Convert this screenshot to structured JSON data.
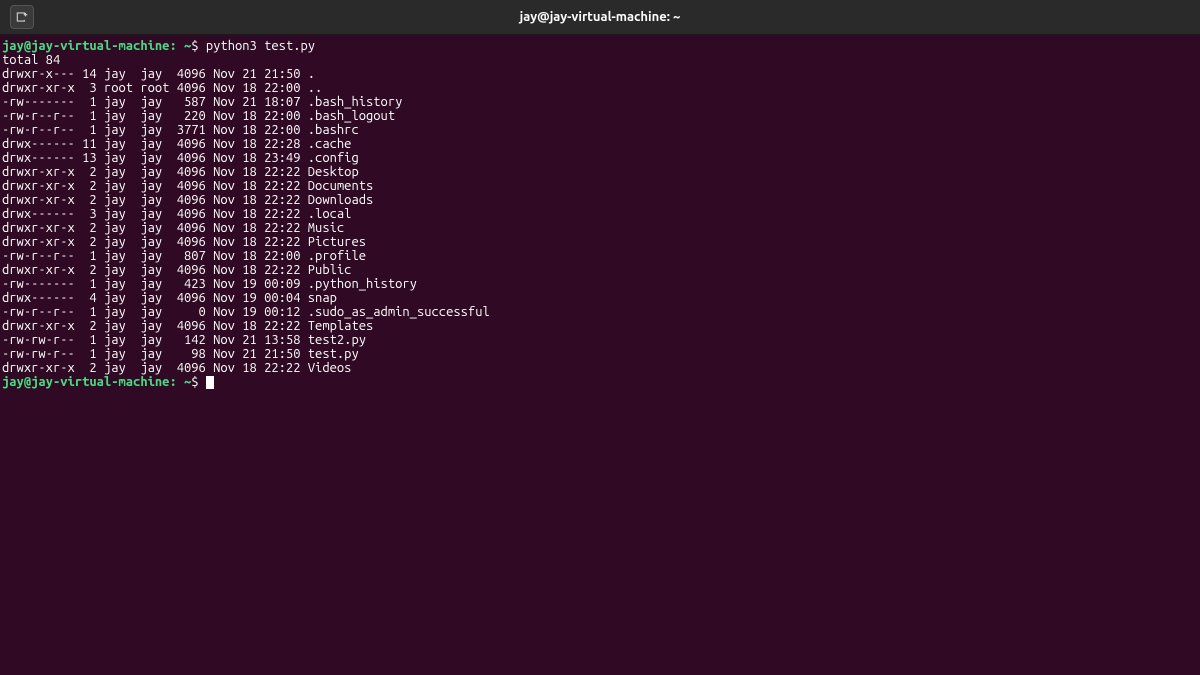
{
  "titlebar": {
    "title": "jay@jay-virtual-machine: ~"
  },
  "prompt1": {
    "userhost": "jay@jay-virtual-machine",
    "sep": ":",
    "path": " ~",
    "dollar": "$ ",
    "command": "python3 test.py"
  },
  "output": {
    "total": "total 84",
    "lines": [
      "drwxr-x--- 14 jay  jay  4096 Nov 21 21:50 .",
      "drwxr-xr-x  3 root root 4096 Nov 18 22:00 ..",
      "-rw-------  1 jay  jay   587 Nov 21 18:07 .bash_history",
      "-rw-r--r--  1 jay  jay   220 Nov 18 22:00 .bash_logout",
      "-rw-r--r--  1 jay  jay  3771 Nov 18 22:00 .bashrc",
      "drwx------ 11 jay  jay  4096 Nov 18 22:28 .cache",
      "drwx------ 13 jay  jay  4096 Nov 18 23:49 .config",
      "drwxr-xr-x  2 jay  jay  4096 Nov 18 22:22 Desktop",
      "drwxr-xr-x  2 jay  jay  4096 Nov 18 22:22 Documents",
      "drwxr-xr-x  2 jay  jay  4096 Nov 18 22:22 Downloads",
      "drwx------  3 jay  jay  4096 Nov 18 22:22 .local",
      "drwxr-xr-x  2 jay  jay  4096 Nov 18 22:22 Music",
      "drwxr-xr-x  2 jay  jay  4096 Nov 18 22:22 Pictures",
      "-rw-r--r--  1 jay  jay   807 Nov 18 22:00 .profile",
      "drwxr-xr-x  2 jay  jay  4096 Nov 18 22:22 Public",
      "-rw-------  1 jay  jay   423 Nov 19 00:09 .python_history",
      "drwx------  4 jay  jay  4096 Nov 19 00:04 snap",
      "-rw-r--r--  1 jay  jay     0 Nov 19 00:12 .sudo_as_admin_successful",
      "drwxr-xr-x  2 jay  jay  4096 Nov 18 22:22 Templates",
      "-rw-rw-r--  1 jay  jay   142 Nov 21 13:58 test2.py",
      "-rw-rw-r--  1 jay  jay    98 Nov 21 21:50 test.py",
      "drwxr-xr-x  2 jay  jay  4096 Nov 18 22:22 Videos"
    ]
  },
  "prompt2": {
    "userhost": "jay@jay-virtual-machine",
    "sep": ":",
    "path": " ~",
    "dollar": "$ "
  }
}
